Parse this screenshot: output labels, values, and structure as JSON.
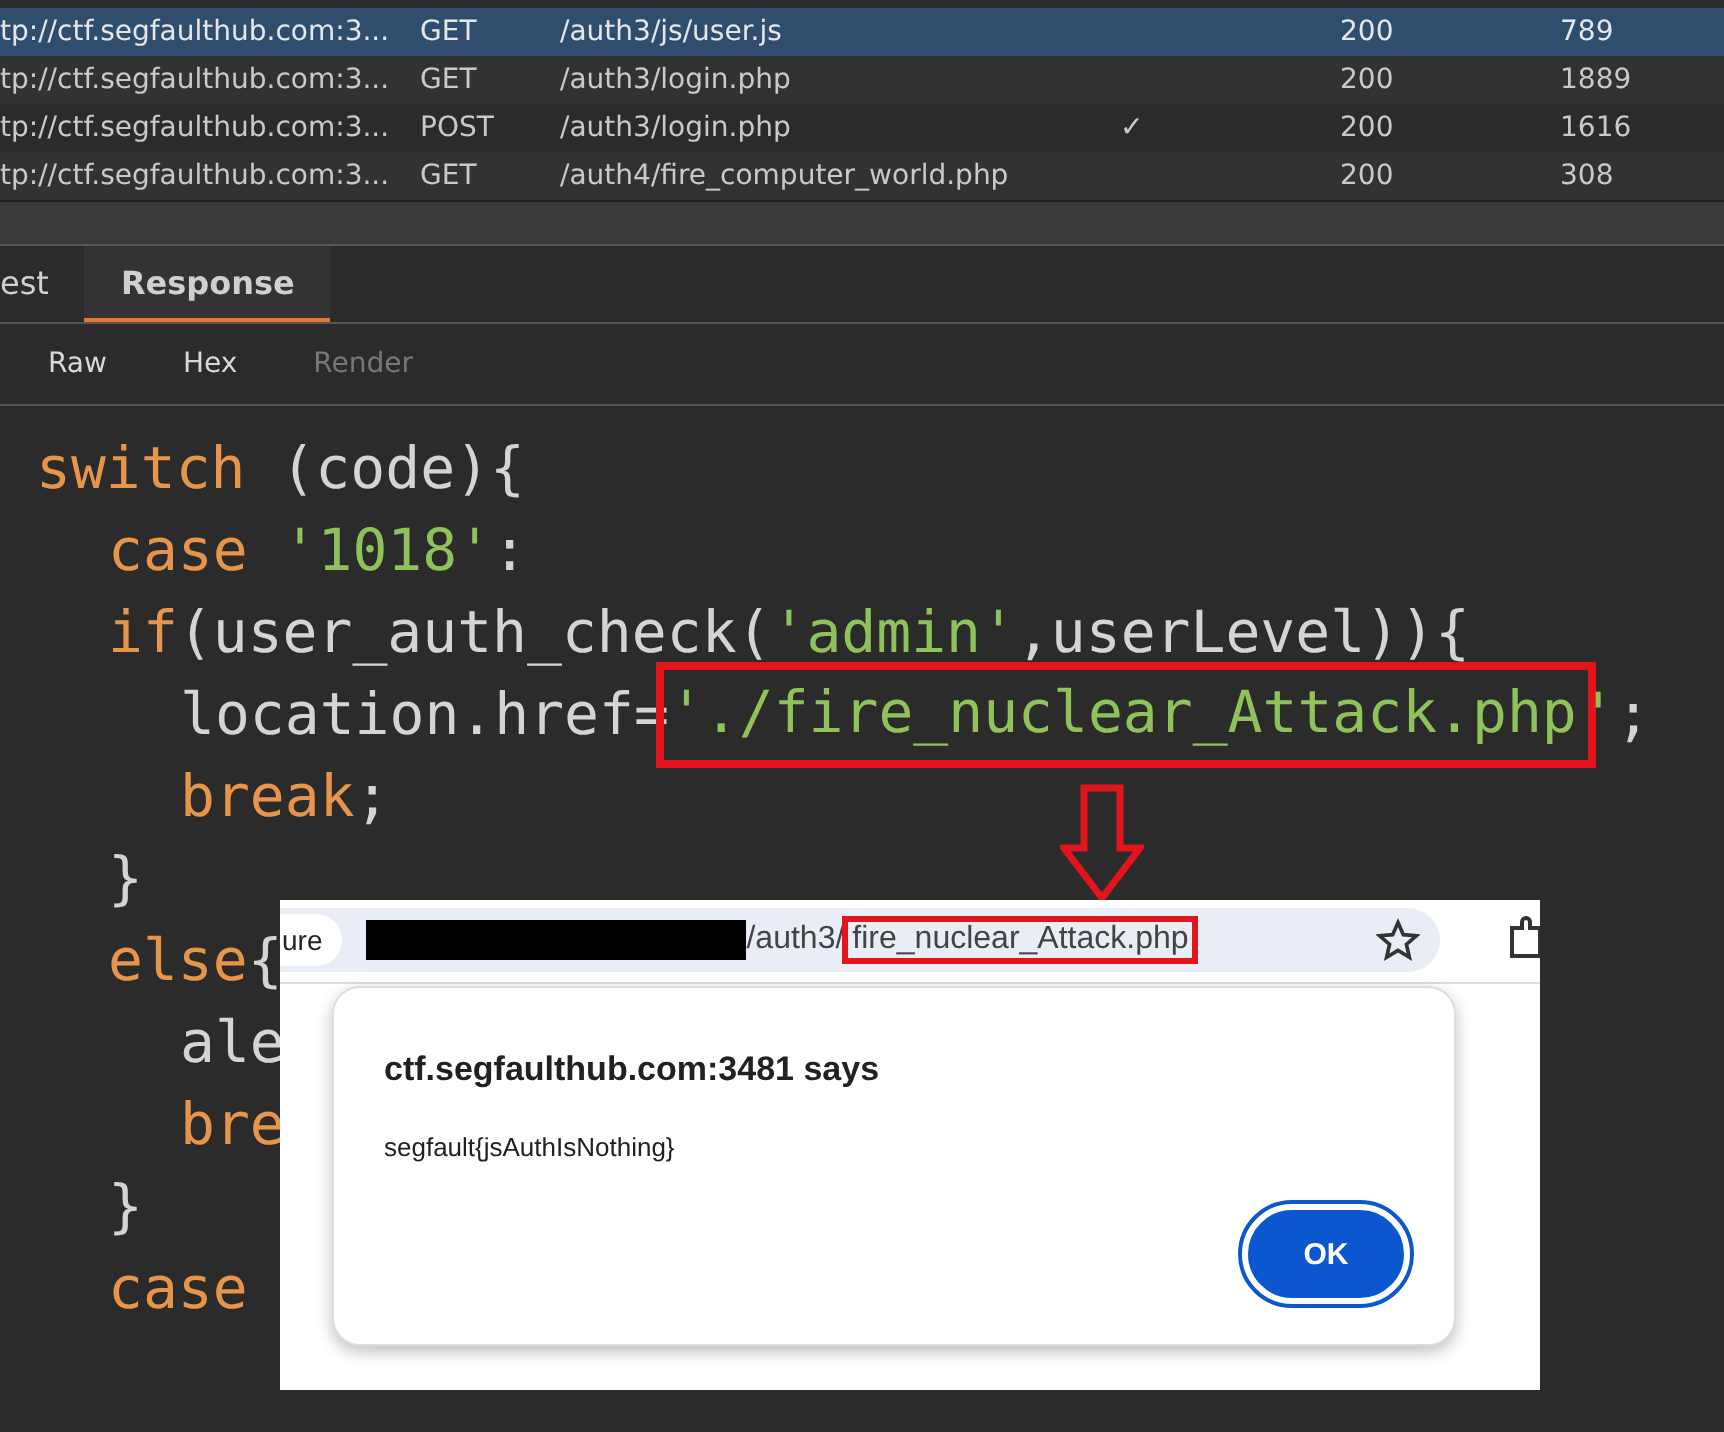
{
  "requests": [
    {
      "host": "tp://ctf.segfaulthub.com:3...",
      "method": "GET",
      "path": "/auth3/js/user.js",
      "status": "200",
      "length": "789",
      "selected": true
    },
    {
      "host": "tp://ctf.segfaulthub.com:3...",
      "method": "GET",
      "path": "/auth3/login.php",
      "status": "200",
      "length": "1889",
      "selected": false
    },
    {
      "host": "tp://ctf.segfaulthub.com:3...",
      "method": "POST",
      "path": "/auth3/login.php",
      "edited_mark": "✓",
      "status": "200",
      "length": "1616",
      "selected": false
    },
    {
      "host": "tp://ctf.segfaulthub.com:3...",
      "method": "GET",
      "path": "/auth4/fire_computer_world.php",
      "status": "200",
      "length": "308",
      "selected": false
    }
  ],
  "tabs": [
    {
      "label": "est",
      "selected": false
    },
    {
      "label": "Response",
      "selected": true
    }
  ],
  "view_modes": [
    {
      "label": "Raw",
      "disabled": false
    },
    {
      "label": "Hex",
      "disabled": false
    },
    {
      "label": "Render",
      "disabled": true
    }
  ],
  "code_lines": [
    {
      "segments": [
        {
          "boxed": false,
          "tokens": [
            {
              "kind": "keyword",
              "text": "switch"
            },
            {
              "kind": "plain",
              "text": " (code){"
            }
          ]
        }
      ],
      "children": [
        {
          "segments": [
            {
              "boxed": false,
              "tokens": [
                {
                  "kind": "keyword",
                  "text": "case"
                },
                {
                  "kind": "string",
                  "text": " '1018'"
                },
                {
                  "kind": "plain",
                  "text": ":"
                }
              ]
            }
          ]
        },
        {
          "segments": [
            {
              "boxed": false,
              "tokens": [
                {
                  "kind": "keyword",
                  "text": "if"
                },
                {
                  "kind": "plain",
                  "text": "(user_auth_check("
                },
                {
                  "kind": "string",
                  "text": "'admin'"
                },
                {
                  "kind": "plain",
                  "text": ",userLevel)){"
                }
              ]
            }
          ],
          "children": [
            {
              "segments": [
                {
                  "boxed": false,
                  "tokens": [
                    {
                      "kind": "plain",
                      "text": "location.href="
                    }
                  ]
                },
                {
                  "boxed": true,
                  "tokens": [
                    {
                      "kind": "string",
                      "text": "'./fire_nuclear_Attack.php"
                    }
                  ]
                },
                {
                  "boxed": false,
                  "tokens": [
                    {
                      "kind": "string",
                      "text": "'"
                    },
                    {
                      "kind": "plain",
                      "text": ";"
                    }
                  ]
                }
              ]
            },
            {
              "segments": [
                {
                  "boxed": false,
                  "tokens": [
                    {
                      "kind": "keyword",
                      "text": "break"
                    },
                    {
                      "kind": "plain",
                      "text": ";"
                    }
                  ]
                }
              ]
            }
          ]
        },
        {
          "segments": [
            {
              "boxed": false,
              "tokens": [
                {
                  "kind": "plain",
                  "text": "}"
                }
              ]
            }
          ]
        },
        {
          "segments": [
            {
              "boxed": false,
              "tokens": [
                {
                  "kind": "keyword",
                  "text": "else"
                },
                {
                  "kind": "plain",
                  "text": "{"
                }
              ]
            }
          ],
          "children": [
            {
              "segments": [
                {
                  "boxed": false,
                  "tokens": [
                    {
                      "kind": "plain",
                      "text": "ale"
                    }
                  ]
                }
              ]
            },
            {
              "segments": [
                {
                  "boxed": false,
                  "tokens": [
                    {
                      "kind": "keyword",
                      "text": "bre"
                    }
                  ]
                }
              ]
            }
          ]
        },
        {
          "segments": [
            {
              "boxed": false,
              "tokens": [
                {
                  "kind": "plain",
                  "text": "}"
                }
              ]
            }
          ]
        },
        {
          "segments": [
            {
              "boxed": false,
              "tokens": [
                {
                  "kind": "keyword",
                  "text": "case"
                }
              ]
            }
          ]
        }
      ]
    }
  ],
  "browser": {
    "security_chip": "ure",
    "url_path": "/auth3/",
    "url_file": "fire_nuclear_Attack.php",
    "dialog": {
      "title": "ctf.segfaulthub.com:3481 says",
      "message": "segfault{jsAuthIsNothing}",
      "button": "OK"
    }
  }
}
